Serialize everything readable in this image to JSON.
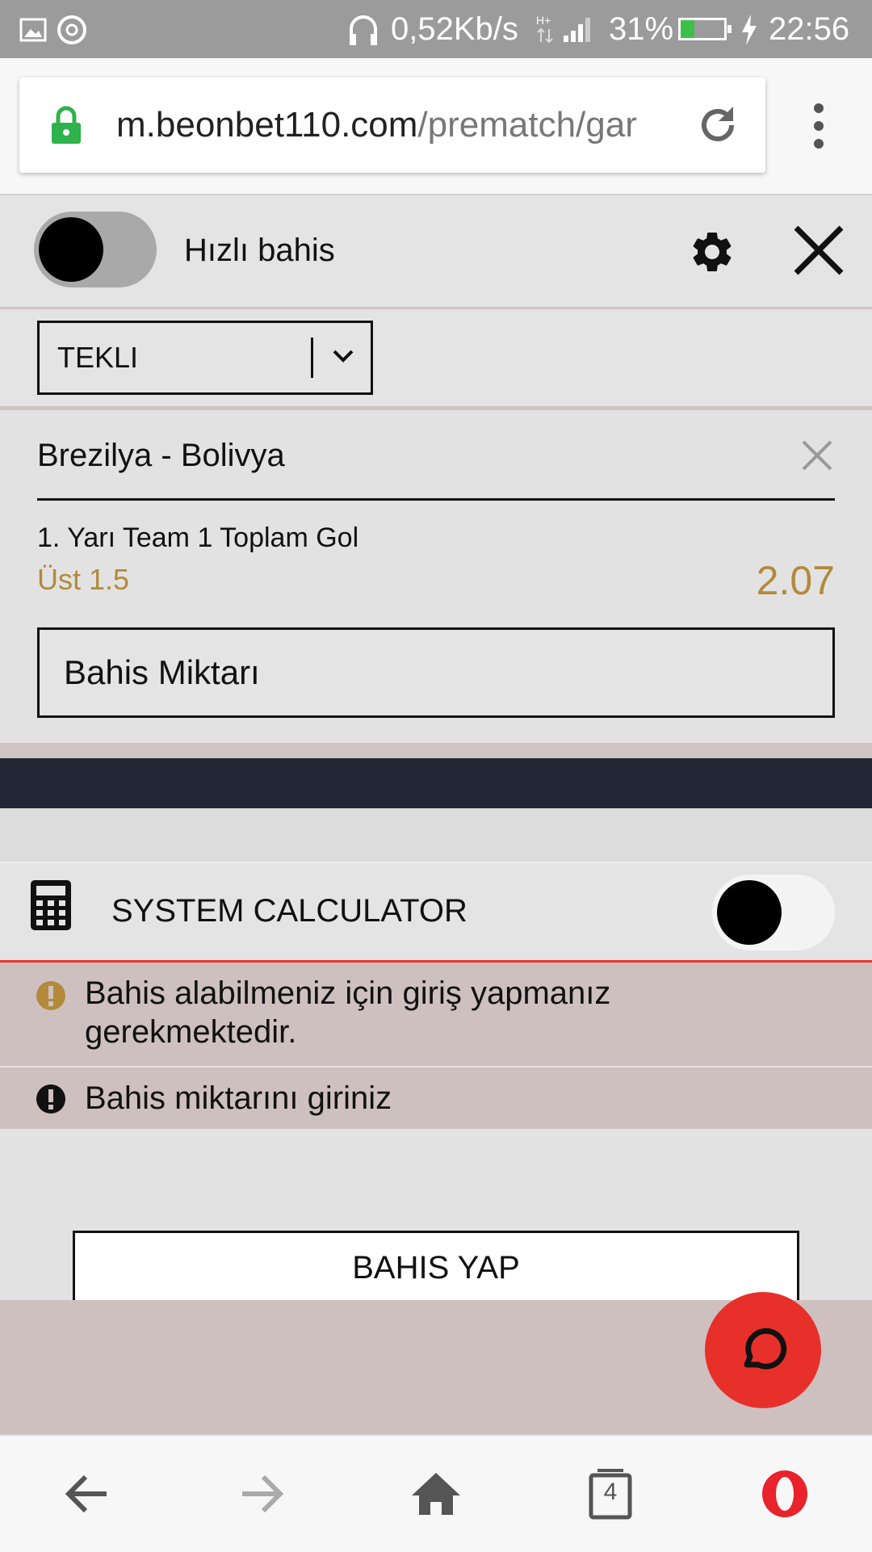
{
  "status_bar": {
    "network_speed": "0,52Kb/s",
    "battery_percent": "31%",
    "time": "22:56",
    "battery_level": 0.31,
    "icons": [
      "image-icon",
      "sync-icon",
      "headphones-icon",
      "hplus-icon",
      "signal-icon",
      "battery-icon",
      "charging-icon"
    ]
  },
  "browser": {
    "url_host": "m.beonbet110.com",
    "url_path": "/prematch/gar",
    "tab_count": "4"
  },
  "quick_bet": {
    "label": "Hızlı bahis",
    "toggle_on": false
  },
  "bet_type": {
    "selected": "TEKLI"
  },
  "bet_slip": {
    "match": "Brezilya - Bolivya",
    "market": "1. Yarı Team 1 Toplam Gol",
    "selection": "Üst 1.5",
    "odds": "2.07",
    "stake_placeholder": "Bahis Miktarı"
  },
  "system_calculator": {
    "label": "SYSTEM CALCULATOR",
    "toggle_on": false
  },
  "alerts": [
    {
      "text": "Bahis alabilmeniz için giriş yapmanız gerekmektedir.",
      "color": "#b28a3a"
    },
    {
      "text": "Bahis miktarını giriniz",
      "color": "#111111"
    }
  ],
  "actions": {
    "bet_button": "BAHIS YAP"
  },
  "colors": {
    "accent_gold": "#b28a3a",
    "chat_red": "#e8302a",
    "navy": "#222634",
    "alert_bg": "#cfc0c0",
    "lock_green": "#2eb24b",
    "opera_red": "#e8232b"
  }
}
